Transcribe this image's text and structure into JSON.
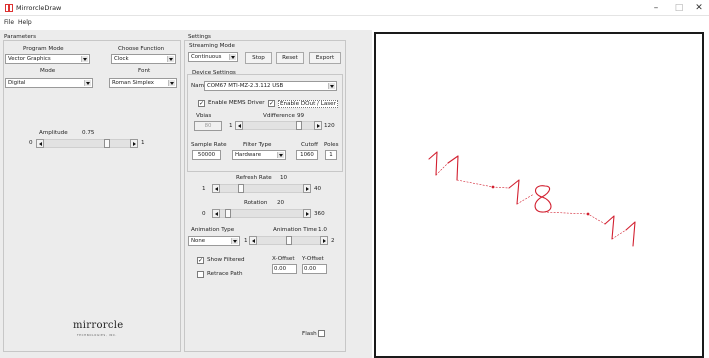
{
  "window": {
    "title": "MirrorcleDraw",
    "minimize": "–",
    "maximize": "□",
    "close": "✕"
  },
  "menu": {
    "file": "File",
    "help": "Help"
  },
  "parameters": {
    "title": "Parameters",
    "program_mode_label": "Program Mode",
    "program_mode_value": "Vector Graphics",
    "choose_function_label": "Choose Function",
    "choose_function_value": "Clock",
    "mode_label": "Mode",
    "mode_value": "Digital",
    "font_label": "Font",
    "font_value": "Roman Simplex",
    "amplitude_label": "Amplitude",
    "amplitude_value": "0.75",
    "amplitude_min": "0",
    "amplitude_max": "1",
    "amplitude_level": 0.75
  },
  "settings": {
    "title": "Settings",
    "streaming_mode_label": "Streaming Mode",
    "streaming_mode_value": "Continuous",
    "stop_label": "Stop",
    "reset_label": "Reset",
    "export_label": "Export",
    "device_settings_title": "Device Settings",
    "name_label": "Name",
    "device_name": "COM67 MTI-MZ-2.3.112 USB",
    "enable_mems_label": "Enable MEMS Driver",
    "enable_mems_checked": true,
    "enable_dout_label": "Enable DOut / Laser",
    "enable_dout_checked": true,
    "vbias_label": "Vbias",
    "vbias_value": "80",
    "vdifference_label": "Vdifference",
    "vdifference_value": "99",
    "vdiff_min": "1",
    "vdiff_max": "120",
    "vdiff_level": 0.82,
    "sample_rate_label": "Sample Rate",
    "sample_rate_value": "50000",
    "filter_type_label": "Filter Type",
    "filter_type_value": "Hardware",
    "cutoff_label": "Cutoff",
    "cutoff_value": "1060",
    "poles_label": "Poles",
    "poles_value": "1"
  },
  "refresh": {
    "label": "Refresh Rate",
    "value": "10",
    "min": "1",
    "max": "40",
    "level": 0.23
  },
  "rotation": {
    "label": "Rotation",
    "value": "20",
    "min": "0",
    "max": "360",
    "level": 0.06
  },
  "animation": {
    "type_label": "Animation Type",
    "type_value": "None",
    "time_label": "Animation Time",
    "time_value": "1.0",
    "time_min": "1",
    "time_max": "2",
    "time_level": 0.5
  },
  "show_filtered": {
    "label": "Show Filtered",
    "checked": true
  },
  "retrace_path": {
    "label": "Retrace Path",
    "checked": false
  },
  "offset": {
    "x_label": "X-Offset",
    "x_value": "0.00",
    "y_label": "Y-Offset",
    "y_value": "0.00"
  },
  "flash": {
    "label": "Flash",
    "checked": false
  },
  "logo": {
    "text": "mirrorcle",
    "sub": "TECHNOLOGIES, INC."
  },
  "preview": {
    "color": "#d22030"
  }
}
